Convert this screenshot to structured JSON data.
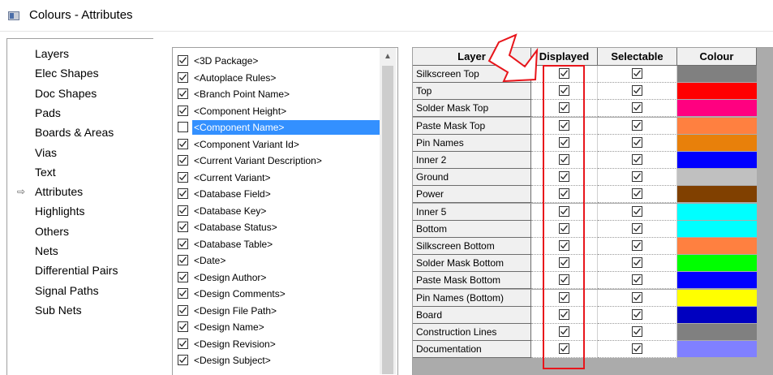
{
  "window": {
    "title": "Colours - Attributes"
  },
  "tree": {
    "items": [
      {
        "label": "Layers",
        "current": false
      },
      {
        "label": "Elec Shapes",
        "current": false
      },
      {
        "label": "Doc Shapes",
        "current": false
      },
      {
        "label": "Pads",
        "current": false
      },
      {
        "label": "Boards & Areas",
        "current": false
      },
      {
        "label": "Vias",
        "current": false
      },
      {
        "label": "Text",
        "current": false
      },
      {
        "label": "Attributes",
        "current": true
      },
      {
        "label": "Highlights",
        "current": false
      },
      {
        "label": "Others",
        "current": false
      },
      {
        "label": "Nets",
        "current": false
      },
      {
        "label": "Differential Pairs",
        "current": false
      },
      {
        "label": "Signal Paths",
        "current": false
      },
      {
        "label": "Sub Nets",
        "current": false
      }
    ]
  },
  "attributes": {
    "items": [
      {
        "label": "<3D Package>",
        "checked": true,
        "selected": false
      },
      {
        "label": "<Autoplace Rules>",
        "checked": true,
        "selected": false
      },
      {
        "label": "<Branch Point Name>",
        "checked": true,
        "selected": false
      },
      {
        "label": "<Component Height>",
        "checked": true,
        "selected": false
      },
      {
        "label": "<Component Name>",
        "checked": false,
        "selected": true
      },
      {
        "label": "<Component Variant Id>",
        "checked": true,
        "selected": false
      },
      {
        "label": "<Current Variant Description>",
        "checked": true,
        "selected": false
      },
      {
        "label": "<Current Variant>",
        "checked": true,
        "selected": false
      },
      {
        "label": "<Database Field>",
        "checked": true,
        "selected": false
      },
      {
        "label": "<Database Key>",
        "checked": true,
        "selected": false
      },
      {
        "label": "<Database Status>",
        "checked": true,
        "selected": false
      },
      {
        "label": "<Database Table>",
        "checked": true,
        "selected": false
      },
      {
        "label": "<Date>",
        "checked": true,
        "selected": false
      },
      {
        "label": "<Design Author>",
        "checked": true,
        "selected": false
      },
      {
        "label": "<Design Comments>",
        "checked": true,
        "selected": false
      },
      {
        "label": "<Design File Path>",
        "checked": true,
        "selected": false
      },
      {
        "label": "<Design Name>",
        "checked": true,
        "selected": false
      },
      {
        "label": "<Design Revision>",
        "checked": true,
        "selected": false
      },
      {
        "label": "<Design Subject>",
        "checked": true,
        "selected": false
      }
    ]
  },
  "grid": {
    "headers": {
      "layer": "Layer",
      "displayed": "Displayed",
      "selectable": "Selectable",
      "colour": "Colour"
    },
    "rows": [
      {
        "layer": "Silkscreen Top",
        "displayed": true,
        "selectable": true,
        "colour": "#808080"
      },
      {
        "layer": "Top",
        "displayed": true,
        "selectable": true,
        "colour": "#ff0000"
      },
      {
        "layer": "Solder Mask Top",
        "displayed": true,
        "selectable": true,
        "colour": "#ff0080"
      },
      {
        "layer": "Paste Mask Top",
        "displayed": true,
        "selectable": true,
        "colour": "#ff8040"
      },
      {
        "layer": "Pin Names",
        "displayed": true,
        "selectable": true,
        "colour": "#e8800a"
      },
      {
        "layer": "Inner 2",
        "displayed": true,
        "selectable": true,
        "colour": "#0000ff"
      },
      {
        "layer": "Ground",
        "displayed": true,
        "selectable": true,
        "colour": "#c0c0c0"
      },
      {
        "layer": "Power",
        "displayed": true,
        "selectable": true,
        "colour": "#804000"
      },
      {
        "layer": "Inner 5",
        "displayed": true,
        "selectable": true,
        "colour": "#00ffff"
      },
      {
        "layer": "Bottom",
        "displayed": true,
        "selectable": true,
        "colour": "#00ffff"
      },
      {
        "layer": "Silkscreen Bottom",
        "displayed": true,
        "selectable": true,
        "colour": "#ff8040"
      },
      {
        "layer": "Solder Mask Bottom",
        "displayed": true,
        "selectable": true,
        "colour": "#00ff00"
      },
      {
        "layer": "Paste Mask Bottom",
        "displayed": true,
        "selectable": true,
        "colour": "#0000ff"
      },
      {
        "layer": "Pin Names (Bottom)",
        "displayed": true,
        "selectable": true,
        "colour": "#ffff00"
      },
      {
        "layer": "Board",
        "displayed": true,
        "selectable": true,
        "colour": "#0000c0"
      },
      {
        "layer": "Construction Lines",
        "displayed": true,
        "selectable": true,
        "colour": "#808080"
      },
      {
        "layer": "Documentation",
        "displayed": true,
        "selectable": true,
        "colour": "#8080ff"
      }
    ]
  },
  "annotation": {
    "color": "#e8151b"
  }
}
